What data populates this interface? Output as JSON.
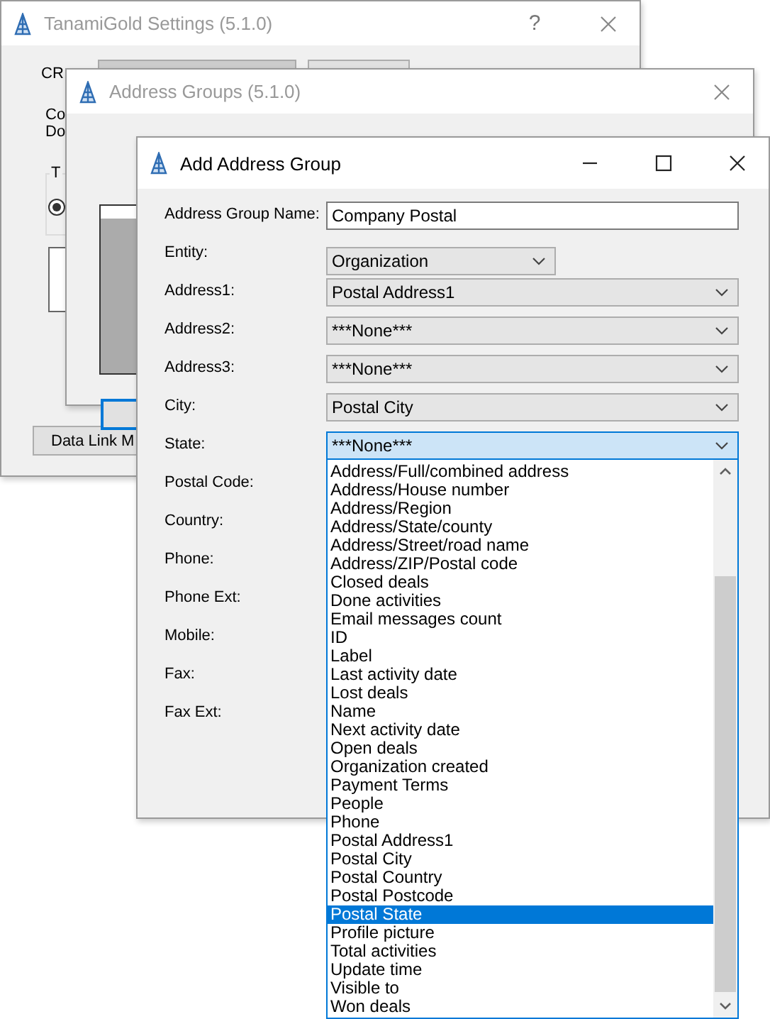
{
  "settings_window": {
    "title": "TanamiGold Settings (5.1.0)",
    "help": "?",
    "crm_label": "CR",
    "labels": [
      "Co",
      "Do"
    ],
    "group_label": "T",
    "radio_selected": true,
    "data_link_button": "Data Link M"
  },
  "address_groups_window": {
    "title": "Address Groups (5.1.0)"
  },
  "add_window": {
    "title": "Add Address Group",
    "fields": [
      {
        "label": "Address Group Name:",
        "kind": "text",
        "value": "Company Postal"
      },
      {
        "label": "Entity:",
        "kind": "combo_small",
        "value": "Organization",
        "expanded": false
      },
      {
        "label": "Address1:",
        "kind": "combo",
        "value": "Postal Address1",
        "expanded": false
      },
      {
        "label": "Address2:",
        "kind": "combo",
        "value": "***None***",
        "expanded": false
      },
      {
        "label": "Address3:",
        "kind": "combo",
        "value": "***None***",
        "expanded": false
      },
      {
        "label": "City:",
        "kind": "combo",
        "value": "Postal City",
        "expanded": false
      },
      {
        "label": "State:",
        "kind": "combo",
        "value": "***None***",
        "expanded": true,
        "options": [
          {
            "label": "Address/Full/combined address",
            "selected": false
          },
          {
            "label": "Address/House number",
            "selected": false
          },
          {
            "label": "Address/Region",
            "selected": false
          },
          {
            "label": "Address/State/county",
            "selected": false
          },
          {
            "label": "Address/Street/road name",
            "selected": false
          },
          {
            "label": "Address/ZIP/Postal code",
            "selected": false
          },
          {
            "label": "Closed deals",
            "selected": false
          },
          {
            "label": "Done activities",
            "selected": false
          },
          {
            "label": "Email messages count",
            "selected": false
          },
          {
            "label": "ID",
            "selected": false
          },
          {
            "label": "Label",
            "selected": false
          },
          {
            "label": "Last activity date",
            "selected": false
          },
          {
            "label": "Lost deals",
            "selected": false
          },
          {
            "label": "Name",
            "selected": false
          },
          {
            "label": "Next activity date",
            "selected": false
          },
          {
            "label": "Open deals",
            "selected": false
          },
          {
            "label": "Organization created",
            "selected": false
          },
          {
            "label": "Payment Terms",
            "selected": false
          },
          {
            "label": "People",
            "selected": false
          },
          {
            "label": "Phone",
            "selected": false
          },
          {
            "label": "Postal Address1",
            "selected": false
          },
          {
            "label": "Postal City",
            "selected": false
          },
          {
            "label": "Postal Country",
            "selected": false
          },
          {
            "label": "Postal Postcode",
            "selected": false
          },
          {
            "label": "Postal State",
            "selected": true
          },
          {
            "label": "Profile picture",
            "selected": false
          },
          {
            "label": "Total activities",
            "selected": false
          },
          {
            "label": "Update time",
            "selected": false
          },
          {
            "label": "Visible to",
            "selected": false
          },
          {
            "label": "Won deals",
            "selected": false
          }
        ]
      },
      {
        "label": "Postal Code:",
        "kind": "label"
      },
      {
        "label": "Country:",
        "kind": "label"
      },
      {
        "label": "Phone:",
        "kind": "label"
      },
      {
        "label": "Phone Ext:",
        "kind": "label"
      },
      {
        "label": "Mobile:",
        "kind": "label"
      },
      {
        "label": "Fax:",
        "kind": "label"
      },
      {
        "label": "Fax Ext:",
        "kind": "label"
      }
    ]
  }
}
